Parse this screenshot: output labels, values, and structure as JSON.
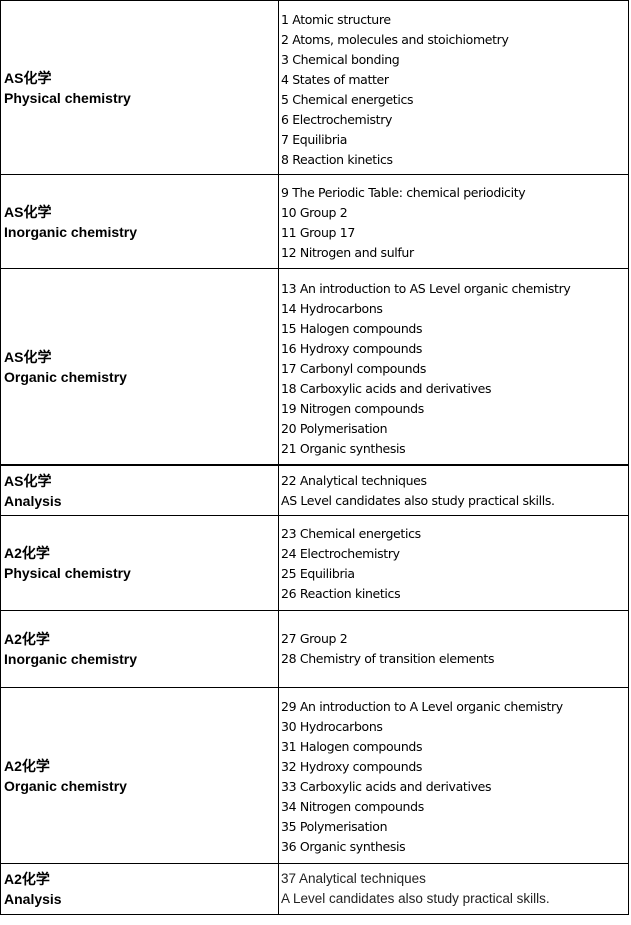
{
  "rows": [
    {
      "level": "AS化学",
      "section": "Physical chemistry",
      "topics": [
        "1 Atomic structure",
        "2 Atoms, molecules and stoichiometry",
        "3 Chemical bonding",
        "4 States of matter",
        "5 Chemical energetics",
        "6 Electrochemistry",
        "7 Equilibria",
        "8 Reaction kinetics"
      ]
    },
    {
      "level": "AS化学",
      "section": "Inorganic chemistry",
      "topics": [
        "9 The Periodic Table: chemical periodicity",
        "10 Group 2",
        "11 Group 17",
        "12 Nitrogen and sulfur"
      ]
    },
    {
      "level": "AS化学",
      "section": "Organic chemistry",
      "topics": [
        "13 An introduction to AS Level organic chemistry",
        "14 Hydrocarbons",
        "15 Halogen compounds",
        "16 Hydroxy compounds",
        "17 Carbonyl compounds",
        "18 Carboxylic acids and derivatives",
        "19 Nitrogen compounds",
        "20 Polymerisation",
        "21 Organic synthesis"
      ]
    },
    {
      "level": "AS化学",
      "section": "Analysis",
      "topics": [
        "22 Analytical techniques",
        "AS Level candidates also study practical skills."
      ]
    },
    {
      "level": "A2化学",
      "section": "Physical chemistry",
      "topics": [
        "23 Chemical energetics",
        "24 Electrochemistry",
        "25 Equilibria",
        "26 Reaction kinetics"
      ]
    },
    {
      "level": "A2化学",
      "section": "Inorganic chemistry",
      "topics": [
        "27 Group 2",
        "28 Chemistry of transition elements"
      ]
    },
    {
      "level": "A2化学",
      "section": "Organic chemistry",
      "topics": [
        "29 An introduction to A Level organic chemistry",
        "30 Hydrocarbons",
        "31 Halogen compounds",
        "32 Hydroxy compounds",
        "33 Carboxylic acids and derivatives",
        "34 Nitrogen compounds",
        "35 Polymerisation",
        "36 Organic synthesis"
      ]
    },
    {
      "level": "A2化学",
      "section": "Analysis",
      "topics": [
        "37 Analytical techniques",
        "A Level candidates also study practical skills."
      ]
    }
  ]
}
